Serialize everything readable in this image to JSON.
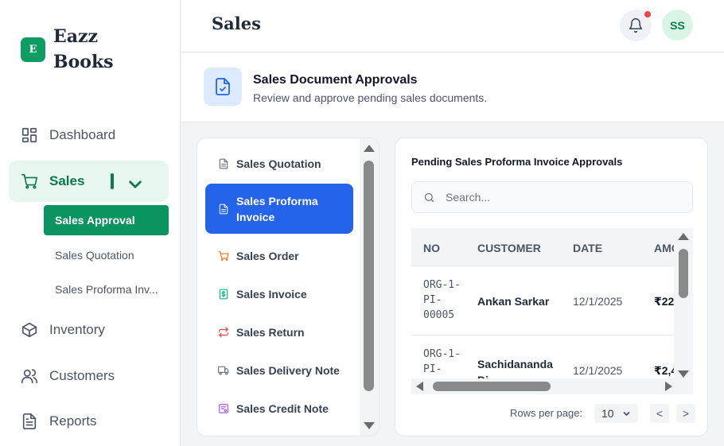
{
  "brand": {
    "badge": "E",
    "name": "Eazz Books",
    "accent": "#0f9d64"
  },
  "sidebar": {
    "items": [
      {
        "label": "Dashboard",
        "icon": "dashboard-icon"
      },
      {
        "label": "Sales",
        "icon": "cart-icon"
      },
      {
        "label": "Inventory",
        "icon": "box-icon"
      },
      {
        "label": "Customers",
        "icon": "users-icon"
      },
      {
        "label": "Reports",
        "icon": "document-icon"
      }
    ],
    "sales_submenu": [
      {
        "label": "Sales Approval"
      },
      {
        "label": "Sales Quotation"
      },
      {
        "label": "Sales Proforma Inv..."
      }
    ]
  },
  "header": {
    "title": "Sales",
    "avatar_initials": "SS",
    "notification_color": "#ef4444"
  },
  "banner": {
    "title": "Sales Document Approvals",
    "subtitle": "Review and approve pending sales documents."
  },
  "doc_types": [
    {
      "label": "Sales Quotation",
      "icon": "document-icon",
      "color": "#6b7280"
    },
    {
      "label": "Sales Proforma Invoice",
      "icon": "document-icon",
      "color": "#dbeafe"
    },
    {
      "label": "Sales Order",
      "icon": "cart-icon",
      "color": "#f97316"
    },
    {
      "label": "Sales Invoice",
      "icon": "invoice-icon",
      "color": "#10b981"
    },
    {
      "label": "Sales Return",
      "icon": "return-icon",
      "color": "#ef4444"
    },
    {
      "label": "Sales Delivery Note",
      "icon": "truck-icon",
      "color": "#6b7280"
    },
    {
      "label": "Sales Credit Note",
      "icon": "credit-note-icon",
      "color": "#a855f7"
    }
  ],
  "pending": {
    "title": "Pending Sales Proforma Invoice Approvals",
    "search_placeholder": "Search...",
    "columns": [
      "NO",
      "CUSTOMER",
      "DATE",
      "AMO"
    ],
    "rows": [
      {
        "no": "ORG-1-PI-00005",
        "customer": "Ankan Sarkar",
        "date": "12/1/2025",
        "amount": "₹22"
      },
      {
        "no": "ORG-1-PI-",
        "customer": "Sachidananda Di",
        "date": "12/1/2025",
        "amount": "₹2,4"
      }
    ],
    "rows_per_page_label": "Rows per page:",
    "rows_per_page_value": "10",
    "prev_label": "<",
    "next_label": ">"
  }
}
